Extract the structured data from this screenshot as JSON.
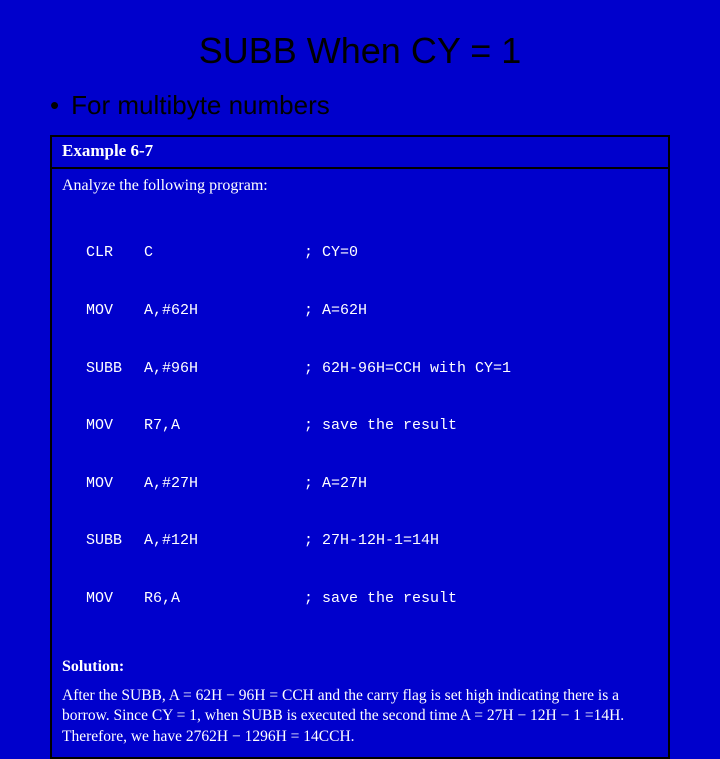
{
  "title": "SUBB When CY = 1",
  "bullet": {
    "dot": "•",
    "text": "For multibyte numbers"
  },
  "example": {
    "label": "Example 6-7",
    "analyze": "Analyze the following program:",
    "code": [
      {
        "mnem": "CLR",
        "ops": "C",
        "cmt": "; CY=0"
      },
      {
        "mnem": "MOV",
        "ops": "A,#62H",
        "cmt": "; A=62H"
      },
      {
        "mnem": "SUBB",
        "ops": "A,#96H",
        "cmt": "; 62H-96H=CCH with CY=1"
      },
      {
        "mnem": "MOV",
        "ops": "R7,A",
        "cmt": "; save the result"
      },
      {
        "mnem": "MOV",
        "ops": "A,#27H",
        "cmt": "; A=27H"
      },
      {
        "mnem": "SUBB",
        "ops": "A,#12H",
        "cmt": "; 27H-12H-1=14H"
      },
      {
        "mnem": "MOV",
        "ops": "R6,A",
        "cmt": "; save the result"
      }
    ],
    "solution_label": "Solution:",
    "solution_text": "After the SUBB, A = 62H − 96H =  CCH and the carry flag is set high indicating there is a borrow. Since CY = 1, when SUBB is executed the second time A = 27H − 12H − 1 =14H. Therefore, we have 2762H − 1296H = 14CCH."
  }
}
